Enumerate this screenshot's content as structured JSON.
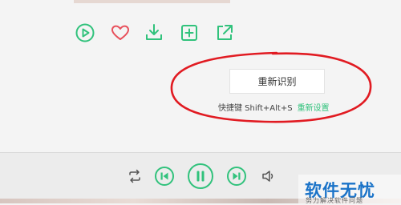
{
  "actions": {
    "items": [
      {
        "icon": "play-circle-icon",
        "label": "play"
      },
      {
        "icon": "heart-icon",
        "label": "favorite"
      },
      {
        "icon": "download-icon",
        "label": "download"
      },
      {
        "icon": "add-square-icon",
        "label": "add"
      },
      {
        "icon": "share-icon",
        "label": "share"
      }
    ]
  },
  "recognize": {
    "button_label": "重新识别",
    "shortcut_label": "快捷键 Shift+Alt+S",
    "reset_link": "重新设置"
  },
  "player": {
    "controls": [
      "repeat-icon",
      "previous-icon",
      "pause-icon",
      "next-icon",
      "volume-icon"
    ]
  },
  "watermark": {
    "logo": "软件无忧",
    "subtitle": "努力解决软件问题"
  },
  "colors": {
    "accent": "#31c27c",
    "annotation": "#e11b22"
  }
}
